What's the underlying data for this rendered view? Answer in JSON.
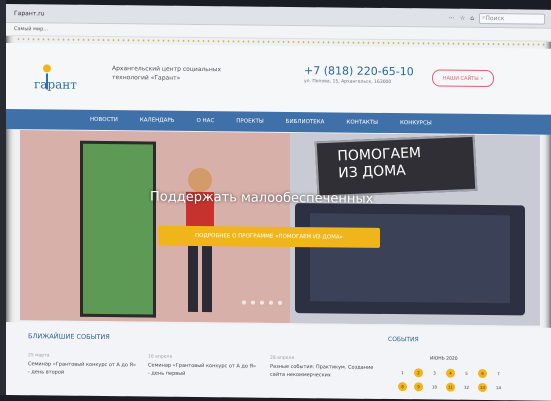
{
  "browser": {
    "url": "Гарант.ru",
    "search_placeholder": "Поиск",
    "bookmark": "Самый мир..."
  },
  "header": {
    "logo_text": "гарант",
    "org_line1": "Архангельский центр социальных",
    "org_line2": "технологий «Гарант»",
    "phone": "+7 (818) 220-65-10",
    "address": "ул. Попова, 15, Архангельск, 163000",
    "help_button": "НАШИ САЙТЫ »"
  },
  "nav": [
    "НОВОСТИ",
    "КАЛЕНДАРЬ",
    "О НАС",
    "ПРОЕКТЫ",
    "БИБЛИОТЕКА",
    "КОНТАКТЫ",
    "КОНКУРСЫ"
  ],
  "hero": {
    "sign_text_line1": "ПОМОГАЕМ",
    "sign_text_line2": "ИЗ ДОМА",
    "title": "Поддержать малообеспеченных",
    "button": "ПОДРОБНЕЕ О ПРОГРАММЕ «ПОМОГАЕМ ИЗ ДОМА»"
  },
  "events": {
    "title": "БЛИЖАЙШИЕ СОБЫТИЯ",
    "items": [
      {
        "date": "25 марта",
        "text": "Семинар «Грантовый конкурс от А до Я» - день второй"
      },
      {
        "date": "16 апреля",
        "text": "Семинар «Грантовый конкурс от А до Я» - день первый"
      },
      {
        "date": "28 апреля",
        "text": "Разные события: Практикум. Создание сайта некоммерческих"
      }
    ]
  },
  "sidebar": {
    "title": "СОБЫТИЯ",
    "calendar_title": "ИЮНЬ 2020",
    "week1": [
      "1",
      "2",
      "3",
      "4",
      "5",
      "6",
      "7"
    ],
    "week2": [
      "8",
      "9",
      "10",
      "11",
      "12",
      "13",
      "14"
    ]
  },
  "colors": {
    "nav": "#3f71a8",
    "accent": "#f1b51c",
    "help": "#e35f6c"
  }
}
